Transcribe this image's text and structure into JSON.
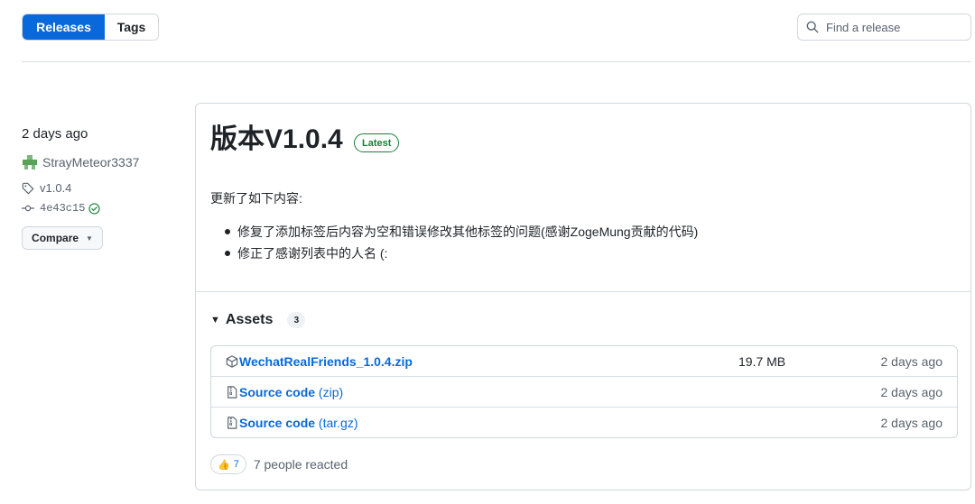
{
  "tabs": [
    {
      "label": "Releases",
      "active": true
    },
    {
      "label": "Tags",
      "active": false
    }
  ],
  "search": {
    "placeholder": "Find a release",
    "value": "",
    "icon": "search-icon"
  },
  "release": {
    "date": "2 days ago",
    "author": "StrayMeteor3337",
    "tag": "v1.0.4",
    "commit": "4e43c15",
    "compare_label": "Compare",
    "title": "版本V1.0.4",
    "badge": "Latest",
    "notes_intro": "更新了如下内容:",
    "notes": [
      "修复了添加标签后内容为空和错误修改其他标签的问题(感谢ZogeMung贡献的代码)",
      "修正了感谢列表中的人名 (:"
    ],
    "assets": {
      "label": "Assets",
      "count": "3",
      "items": [
        {
          "name": "WechatRealFriends_1.0.4.zip",
          "suffix": "",
          "size": "19.7 MB",
          "date": "2 days ago",
          "icon": "package-icon"
        },
        {
          "name": "Source code",
          "suffix": " (zip)",
          "size": "",
          "date": "2 days ago",
          "icon": "file-zip-icon"
        },
        {
          "name": "Source code",
          "suffix": " (tar.gz)",
          "size": "",
          "date": "2 days ago",
          "icon": "file-zip-icon"
        }
      ]
    },
    "reactions": {
      "emoji": "👍",
      "count": "7",
      "text": "7 people reacted"
    }
  },
  "colors": {
    "accent": "#0969da",
    "success": "#1a7f37",
    "border": "#d0d7de",
    "muted": "#59636e"
  }
}
